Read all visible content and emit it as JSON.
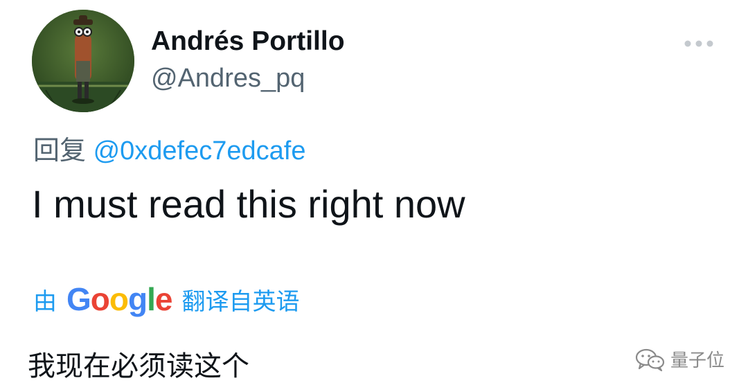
{
  "tweet": {
    "author": {
      "display_name": "Andrés Portillo",
      "handle": "@Andres_pq",
      "avatar_icon": "cartoon-character-avatar"
    },
    "more_icon": "ellipsis-icon",
    "reply": {
      "prefix": "回复",
      "mention": "@0xdefec7edcafe"
    },
    "text": "I must read this right now",
    "translation": {
      "prefix": "由",
      "provider": [
        "G",
        "o",
        "o",
        "g",
        "l",
        "e"
      ],
      "suffix": "翻译自英语",
      "text": "我现在必须读这个"
    }
  },
  "watermark": {
    "icon": "wechat-icon",
    "text": "量子位"
  },
  "colors": {
    "text": "#0f1419",
    "secondary": "#536471",
    "link": "#1d9bf0",
    "google": [
      "#4285f4",
      "#ea4335",
      "#fbbc05",
      "#4285f4",
      "#34a853",
      "#ea4335"
    ]
  }
}
